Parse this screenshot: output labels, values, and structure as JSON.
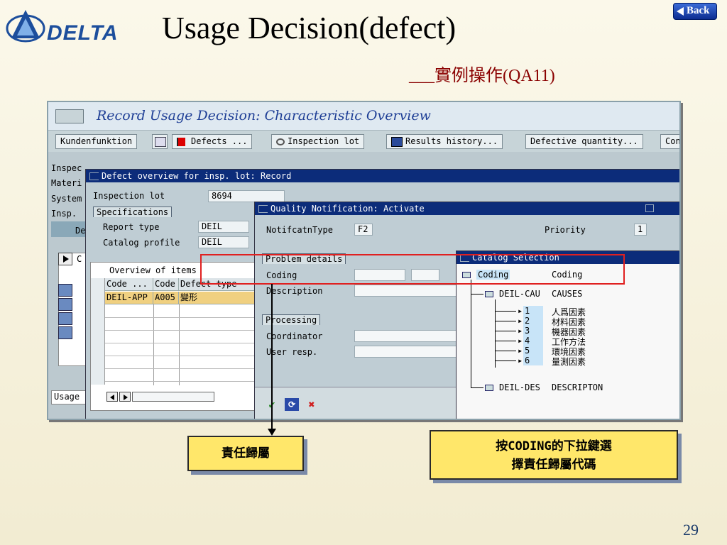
{
  "slide": {
    "title": "Usage Decision(defect)",
    "subtitle": "___實例操作(QA11)",
    "back_label": "Back",
    "page_number": "29",
    "logo_text": "DELTA"
  },
  "sap": {
    "window_title": "Record Usage Decision: Characteristic Overview",
    "toolbar": [
      {
        "label": "Kundenfunktion"
      },
      {
        "label": "Defects ..."
      },
      {
        "label": "Inspection lot"
      },
      {
        "label": "Results history..."
      },
      {
        "label": "Defective quantity..."
      },
      {
        "label": "Con"
      }
    ],
    "left_labels": [
      "Inspec",
      "Materi",
      "System",
      "Insp.",
      "De",
      "C",
      "Usage"
    ],
    "defect_dialog": {
      "title": "Defect overview for insp. lot: Record",
      "inspection_lot_label": "Inspection lot",
      "inspection_lot_value": "8694",
      "specifications_tab": "Specifications",
      "report_type_label": "Report type",
      "report_type_value": "DEIL",
      "catalog_profile_label": "Catalog profile",
      "catalog_profile_value": "DEIL",
      "overview_title": "Overview of items",
      "columns": [
        "Code ...",
        "Code",
        "Defect type"
      ],
      "rows": [
        [
          "DEIL-APP",
          "A005",
          "變形"
        ]
      ]
    },
    "qn_dialog": {
      "title": "Quality Notification: Activate",
      "notif_type_label": "NotifcatnType",
      "notif_type_value": "F2",
      "priority_label": "Priority",
      "priority_value": "1",
      "problem_details_tab": "Problem details",
      "coding_label": "Coding",
      "description_label": "Description",
      "processing_tab": "Processing",
      "coordinator_label": "Coordinator",
      "user_resp_label": "User resp."
    },
    "catalog_dialog": {
      "title": "Catalog Selection",
      "root_code": "Coding",
      "root_text": "Coding",
      "group1_code": "DEIL-CAU",
      "group1_text": "CAUSES",
      "items": [
        {
          "code": "1",
          "text": "人爲因素"
        },
        {
          "code": "2",
          "text": "材料因素"
        },
        {
          "code": "3",
          "text": "機器因素"
        },
        {
          "code": "4",
          "text": "工作方法"
        },
        {
          "code": "5",
          "text": "環境因素"
        },
        {
          "code": "6",
          "text": "量測因素"
        }
      ],
      "group2_code": "DEIL-DES",
      "group2_text": "DESCRIPTON"
    }
  },
  "callouts": {
    "left": "責任歸屬",
    "right_line1": "按CODING的下拉鍵選",
    "right_line2": "擇責任歸屬代碼"
  },
  "colors": {
    "sap_blue": "#0c2c7a",
    "title_blue": "#1f3f96",
    "callout_yellow": "#ffe76a",
    "highlight_red": "#e02020",
    "subtitle_red": "#8a0000"
  }
}
